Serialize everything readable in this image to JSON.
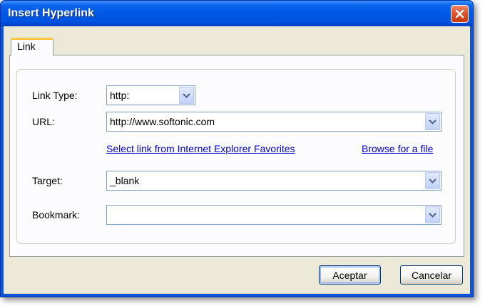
{
  "window": {
    "title": "Insert Hyperlink",
    "close_icon": "close-icon"
  },
  "tabs": [
    {
      "label": "Link",
      "active": true
    }
  ],
  "form": {
    "link_type": {
      "label": "Link Type:",
      "value": "http:"
    },
    "url": {
      "label": "URL:",
      "value": "http://www.softonic.com"
    },
    "favorites_link": "Select link from Internet Explorer Favorites",
    "browse_link": "Browse for a file",
    "target": {
      "label": "Target:",
      "value": "_blank"
    },
    "bookmark": {
      "label": "Bookmark:",
      "value": ""
    }
  },
  "buttons": {
    "ok": "Aceptar",
    "cancel": "Cancelar"
  },
  "colors": {
    "title_bar": "#0058e6",
    "dialog_bg": "#ece9d8",
    "tab_accent": "#ffc83c",
    "link": "#0000cc",
    "close_button": "#e0552f"
  }
}
